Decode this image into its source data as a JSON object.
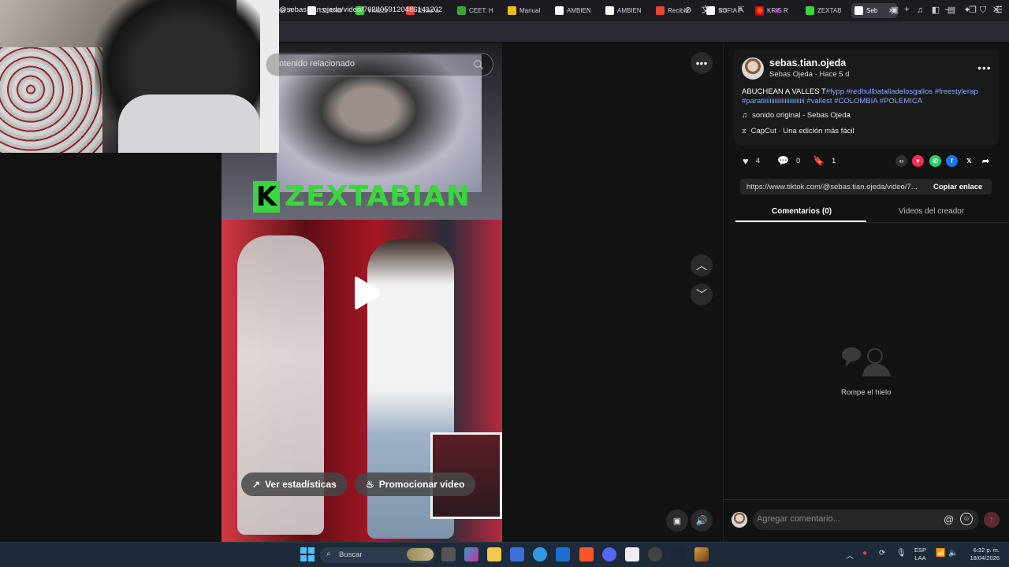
{
  "browser": {
    "tabs": [
      {
        "label": "na: A",
        "favicon": "generic",
        "color": "#555555"
      },
      {
        "label": "ISLAND",
        "favicon": "chrome-icon",
        "color": "#ffffff"
      },
      {
        "label": "Yhazzir",
        "favicon": "kick-icon",
        "color": "#39d63c"
      },
      {
        "label": "Estás a",
        "favicon": "gmail-icon",
        "color": "#ea4335"
      },
      {
        "label": "CEET: H",
        "favicon": "sena-icon",
        "color": "#39a935"
      },
      {
        "label": "Manual",
        "favicon": "drive-icon",
        "color": "#fbbc04"
      },
      {
        "label": "AMBIEN",
        "favicon": "notion-icon",
        "color": "#ffffff"
      },
      {
        "label": "AMBIEN",
        "favicon": "notion-icon",
        "color": "#ffffff"
      },
      {
        "label": "Recibid",
        "favicon": "gmail-icon",
        "color": "#ea4335"
      },
      {
        "label": "SOFIA P",
        "favicon": "sofia-icon",
        "color": "#ffffff"
      },
      {
        "label": "KRIS R",
        "favicon": "youtube-icon",
        "color": "#ff0000"
      },
      {
        "label": "ZEXTAB",
        "favicon": "kick-icon",
        "color": "#39d63c"
      },
      {
        "label": "Seb",
        "favicon": "tiktok-icon",
        "color": "#ffffff",
        "active": true
      }
    ],
    "url": "@sebas.tian.ojeda/video/7628059120486141202"
  },
  "video": {
    "search_placeholder": "ntenido relacionado",
    "brand_letter": "K",
    "brand_text": "ZEXTABIAN",
    "stats_button": "Ver estadísticas",
    "promote_button": "Promocionar video"
  },
  "post": {
    "username": "sebas.tian.ojeda",
    "subline": "Sebas Ojeda · Hace 5 d",
    "caption_plain": "ABUCHEAN A VALLES T",
    "caption_tags": "#fypp #redbullbatalladelosgallos #freestylerap #paratiiiiiiiiiiiiiiiiiiiiiiiii #vallest #COLOMBIA #POLEMICA",
    "music": "sonido original - Sebas Ojeda",
    "capcut": "CapCut · Una edición más fácil",
    "likes": "4",
    "comments": "0",
    "saves": "1",
    "link": "https://www.tiktok.com/@sebas.tian.ojeda/video/7...",
    "copy_link": "Copiar enlace",
    "tab_comments": "Comentarios (0)",
    "tab_creator": "Videos del creador",
    "empty_text": "Rompe el hielo",
    "comment_placeholder": "Agregar comentario..."
  },
  "taskbar": {
    "search": "Buscar",
    "lang_line1": "ESP",
    "lang_line2": "LAA",
    "time": "6:32 p. m.",
    "date": "18/04/2026"
  }
}
